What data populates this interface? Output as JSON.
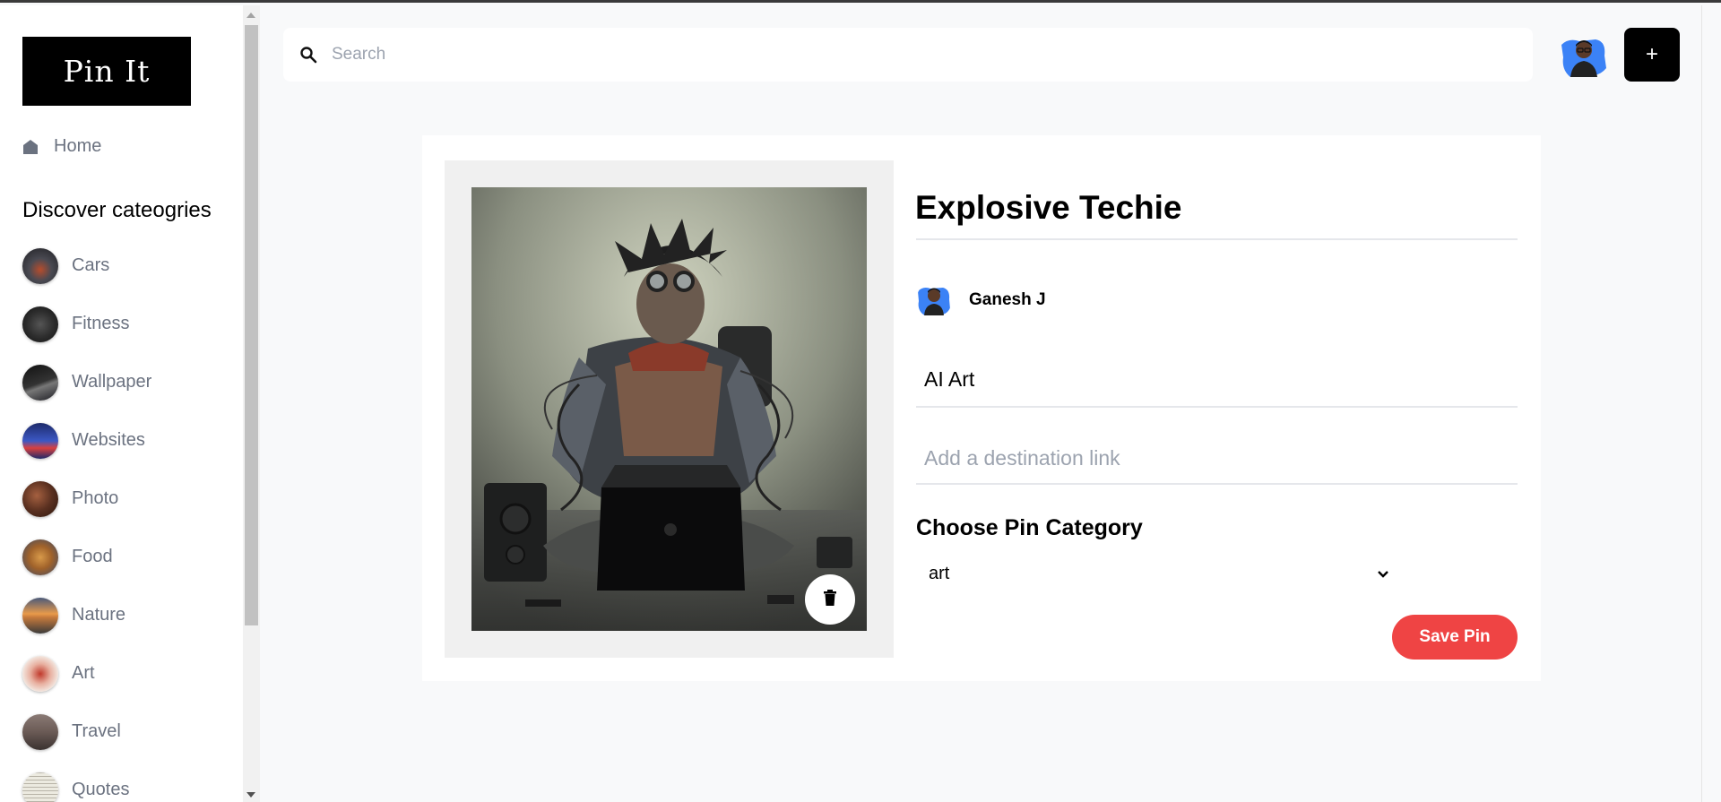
{
  "app": {
    "logo_text": "Pin It"
  },
  "sidebar": {
    "home_label": "Home",
    "discover_title": "Discover cateogries",
    "categories": [
      {
        "label": "Cars",
        "color": "#4a4a52"
      },
      {
        "label": "Fitness",
        "color": "#2e2e2e"
      },
      {
        "label": "Wallpaper",
        "color": "#1c1c22"
      },
      {
        "label": "Websites",
        "color": "#2c3a7a"
      },
      {
        "label": "Photo",
        "color": "#5a3020"
      },
      {
        "label": "Food",
        "color": "#a0622a"
      },
      {
        "label": "Nature",
        "color": "#c67a3c"
      },
      {
        "label": "Art",
        "color": "#c0392b"
      },
      {
        "label": "Travel",
        "color": "#6a5a55"
      },
      {
        "label": "Quotes",
        "color": "#eceae0"
      }
    ]
  },
  "topbar": {
    "search_placeholder": "Search",
    "search_value": "",
    "add_label": "+"
  },
  "pin": {
    "title": "Explosive Techie",
    "author_name": "Ganesh J",
    "about": "AI Art",
    "destination_placeholder": "Add a destination link",
    "category_heading": "Choose Pin Category",
    "category_selected": "art",
    "save_label": "Save Pin"
  },
  "colors": {
    "accent_save": "#ef4444",
    "logo_bg": "#000000",
    "muted_text": "#6b7280"
  }
}
